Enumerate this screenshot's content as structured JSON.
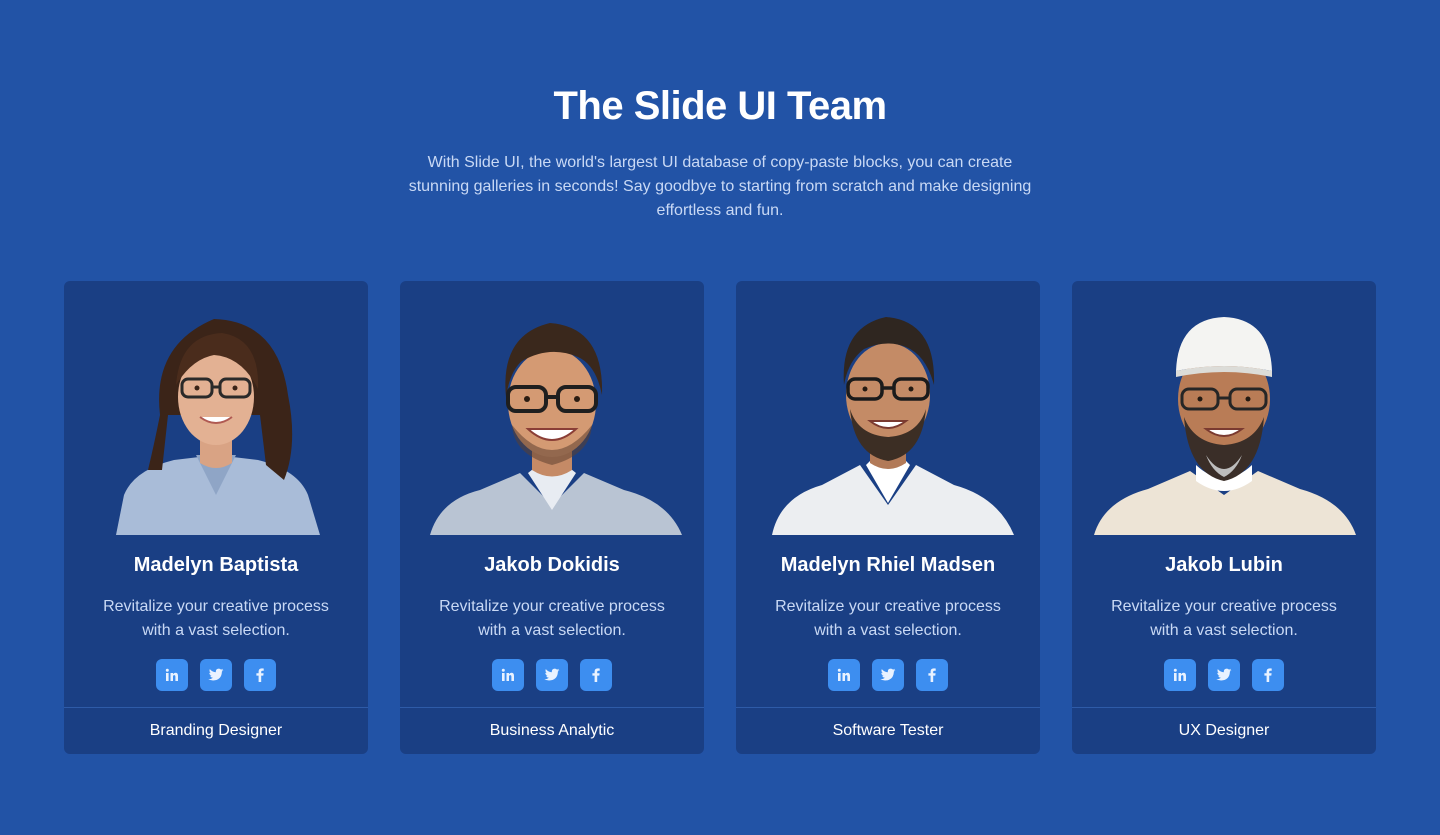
{
  "header": {
    "title": "The Slide UI Team",
    "subtitle": "With Slide UI, the world's largest UI database of copy-paste blocks, you can create stunning galleries in seconds! Say goodbye to starting from scratch and make designing effortless and fun."
  },
  "colors": {
    "background": "#2253a6",
    "card": "#1a3f84",
    "social_button": "#3d8ef0",
    "muted_text": "#c9d9f5"
  },
  "team": [
    {
      "name": "Madelyn Baptista",
      "description": "Revitalize your creative process with a vast selection.",
      "role": "Branding Designer",
      "portrait": "woman-glasses-portrait"
    },
    {
      "name": "Jakob Dokidis",
      "description": "Revitalize your creative process with a vast selection.",
      "role": "Business Analytic",
      "portrait": "man-glasses-portrait"
    },
    {
      "name": "Madelyn Rhiel Madsen",
      "description": "Revitalize your creative process with a vast selection.",
      "role": "Software Tester",
      "portrait": "man-beard-glasses-portrait"
    },
    {
      "name": "Jakob Lubin",
      "description": "Revitalize your creative process with a vast selection.",
      "role": "UX Designer",
      "portrait": "man-cap-beard-portrait"
    }
  ],
  "social_icons": [
    "linkedin-icon",
    "twitter-icon",
    "facebook-icon"
  ]
}
